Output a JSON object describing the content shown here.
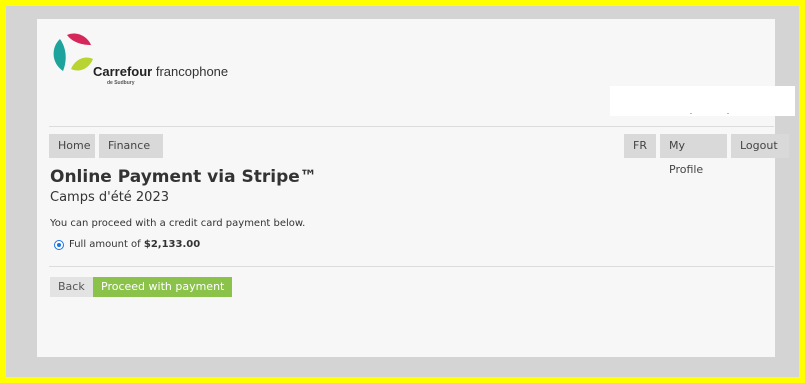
{
  "header": {
    "brand_bold": "Carrefour",
    "brand_rest": " francophone",
    "brand_sub": "de Sudbury"
  },
  "nav": {
    "left": [
      "Home",
      "Finance"
    ],
    "right": [
      "FR",
      "My Profile",
      "Logout"
    ]
  },
  "main": {
    "title": "Online Payment via Stripe™",
    "subtitle": "Camps d'été 2023",
    "note": "You can proceed with a credit card payment below.",
    "option_prefix": "Full amount of ",
    "option_amount": "$2,133.00"
  },
  "actions": {
    "back_label": "Back",
    "proceed_label": "Proceed with payment"
  },
  "colors": {
    "accent_green": "#8bc34a",
    "logo_red": "#d6275a",
    "logo_teal": "#1ba39c",
    "logo_lime": "#b7d432"
  }
}
